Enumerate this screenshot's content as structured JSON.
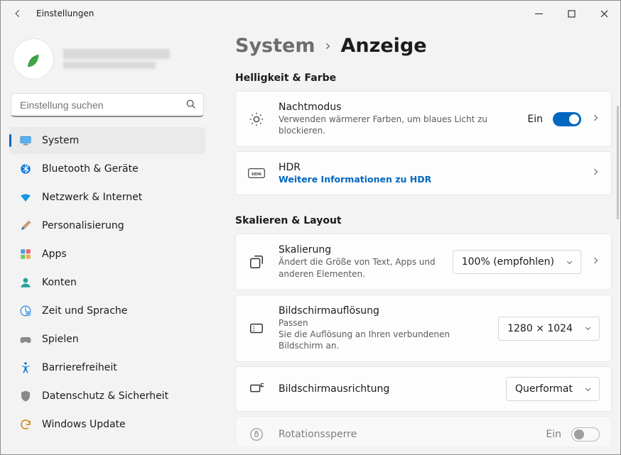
{
  "window": {
    "title": "Einstellungen"
  },
  "search": {
    "placeholder": "Einstellung suchen"
  },
  "nav": {
    "items": [
      {
        "label": "System"
      },
      {
        "label": "Bluetooth & Geräte"
      },
      {
        "label": "Netzwerk & Internet"
      },
      {
        "label": "Personalisierung"
      },
      {
        "label": "Apps"
      },
      {
        "label": "Konten"
      },
      {
        "label": "Zeit und Sprache"
      },
      {
        "label": "Spielen"
      },
      {
        "label": "Barrierefreiheit"
      },
      {
        "label": "Datenschutz & Sicherheit"
      },
      {
        "label": "Windows Update"
      }
    ]
  },
  "breadcrumb": {
    "root": "System",
    "leaf": "Anzeige"
  },
  "sections": {
    "brightness": {
      "title": "Helligkeit & Farbe",
      "night": {
        "title": "Nachtmodus",
        "sub": "Verwenden wärmerer Farben, um blaues Licht zu blockieren.",
        "state_label": "Ein"
      },
      "hdr": {
        "title": "HDR",
        "link": "Weitere Informationen zu HDR"
      }
    },
    "scale": {
      "title": "Skalieren & Layout",
      "scaling": {
        "title": "Skalierung",
        "sub": "Ändert die Größe von Text, Apps und anderen Elementen.",
        "value": "100% (empfohlen)"
      },
      "resolution": {
        "title": "Bildschirmauflösung",
        "sub1": "Passen",
        "sub2": "Sie die Auflösung an Ihren verbundenen Bildschirm an.",
        "value": "1280 × 1024"
      },
      "orientation": {
        "title": "Bildschirmausrichtung",
        "value": "Querformat"
      },
      "rotation": {
        "title": "Rotationssperre",
        "state_label": "Ein"
      }
    }
  },
  "colors": {
    "accent": "#0067c0"
  }
}
